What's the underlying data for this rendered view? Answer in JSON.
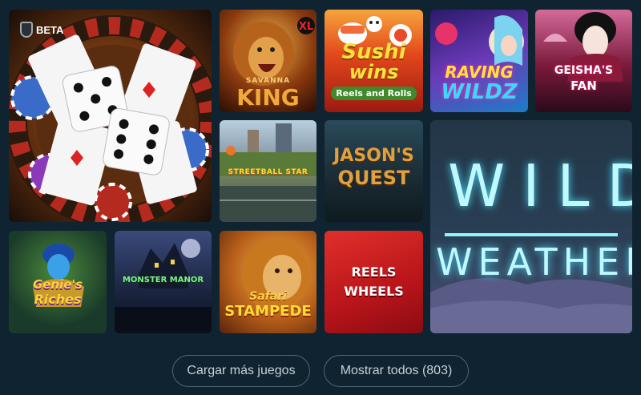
{
  "badge": {
    "label": "BETA"
  },
  "games": {
    "savanna": {
      "line1": "SAVANNA",
      "line2": "KING"
    },
    "sushi": {
      "line1": "Sushi",
      "line2": "wins",
      "line3": "Reels and Rolls"
    },
    "raving": {
      "line1": "RAVING",
      "line2": "WILDZ"
    },
    "geisha": {
      "line1": "GEISHA'S",
      "line2": "FAN"
    },
    "street": {
      "line1": "STREETBALL STAR"
    },
    "jason": {
      "line1": "JASON'S",
      "line2": "QUEST"
    },
    "wild": {
      "line1": "WILD",
      "line2": "WEATHER"
    },
    "genie": {
      "line1": "Genie's",
      "line2": "Riches"
    },
    "monster": {
      "line1": "MONSTER MANOR"
    },
    "safari": {
      "line1": "Safari",
      "line2": "STAMPEDE"
    },
    "reels": {
      "line1": "REELS",
      "line2": "WHEELS"
    }
  },
  "buttons": {
    "load_more": "Cargar más juegos",
    "show_all": "Mostrar todos (803)"
  }
}
